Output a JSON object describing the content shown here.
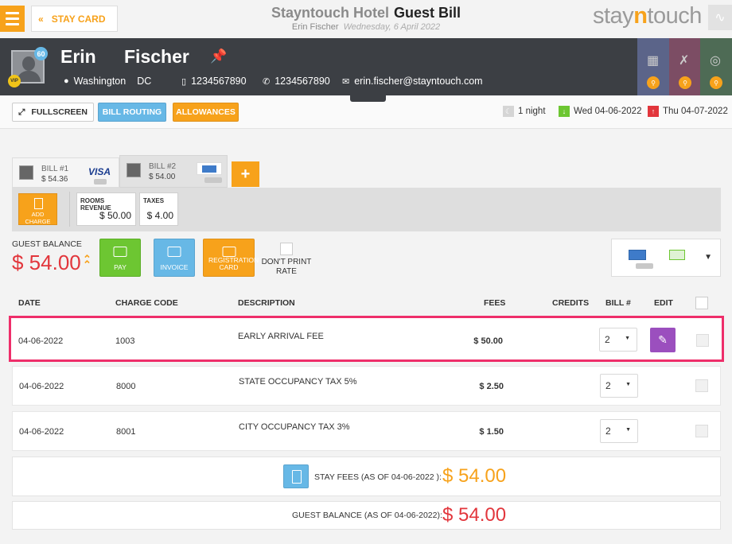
{
  "header": {
    "stay_card_label": "STAY CARD",
    "hotel_name": "Stayntouch Hotel",
    "page_title": "Guest Bill",
    "guest_name_sub": "Erin Fischer",
    "date_sub": "Wednesday, 6 April 2022",
    "logo_before": "stay",
    "logo_n": "n",
    "logo_after": "touch"
  },
  "guest": {
    "first_name": "Erin",
    "last_name": "Fischer",
    "badge_count": "60",
    "vip": "VIP",
    "city": "Washington",
    "state": "DC",
    "mobile": "1234567890",
    "phone": "1234567890",
    "email": "erin.fischer@stayntouch.com"
  },
  "toolbar": {
    "fullscreen": "FULLSCREEN",
    "bill_routing": "BILL ROUTING",
    "allowances": "ALLOWANCES",
    "nights": "1 night",
    "arrival": "Wed 04-06-2022",
    "departure": "Thu 04-07-2022"
  },
  "bills": [
    {
      "title": "BILL #1",
      "amount": "$ 54.36",
      "card": "VISA"
    },
    {
      "title": "BILL #2",
      "amount": "$ 54.00"
    }
  ],
  "add_bill": "+",
  "bill_panel": {
    "add_charge": "ADD CHARGE",
    "rooms_revenue_label": "ROOMS REVENUE",
    "rooms_revenue_value": "$ 50.00",
    "taxes_label": "TAXES",
    "taxes_value": "$ 4.00"
  },
  "balance": {
    "label": "GUEST BALANCE",
    "value": "$ 54.00",
    "pay": "PAY",
    "invoice": "INVOICE",
    "registration": "REGISTRATION CARD",
    "dont_print": "DON'T PRINT RATE"
  },
  "table": {
    "headers": {
      "date": "DATE",
      "code": "CHARGE CODE",
      "desc": "DESCRIPTION",
      "fees": "FEES",
      "credits": "CREDITS",
      "bill": "BILL #",
      "edit": "EDIT"
    },
    "rows": [
      {
        "date": "04-06-2022",
        "code": "1003",
        "desc": "EARLY ARRIVAL FEE",
        "fees": "$ 50.00",
        "bill": "2"
      },
      {
        "date": "04-06-2022",
        "code": "8000",
        "desc": "STATE OCCUPANCY TAX 5%",
        "fees": "$ 2.50",
        "bill": "2"
      },
      {
        "date": "04-06-2022",
        "code": "8001",
        "desc": "CITY OCCUPANCY TAX 3%",
        "fees": "$ 1.50",
        "bill": "2"
      }
    ]
  },
  "summary": {
    "stay_fees_label": "STAY FEES (AS OF 04-06-2022 ):",
    "stay_fees_value": "$ 54.00",
    "guest_balance_label": "GUEST BALANCE (AS OF 04-06-2022):",
    "guest_balance_value": "$ 54.00"
  },
  "colors": {
    "accent_orange": "#f7a21b",
    "accent_blue": "#67b8e6",
    "balance_red": "#e2363c",
    "highlight_pink": "#ee2e6a",
    "edit_purple": "#9b4fbe"
  }
}
